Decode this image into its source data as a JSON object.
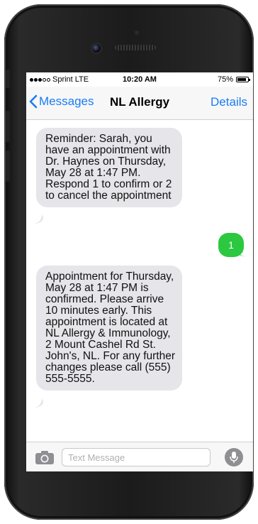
{
  "status_bar": {
    "carrier": "Sprint",
    "network": "LTE",
    "time": "10:20 AM",
    "battery": "75%",
    "signal_bars_filled": 3,
    "signal_bars_total": 5
  },
  "nav": {
    "back_label": "Messages",
    "title": "NL Allergy",
    "details_label": "Details"
  },
  "messages": [
    {
      "direction": "incoming",
      "text": "Reminder: Sarah, you have an appointment with Dr. Haynes on Thursday, May 28 at 1:47 PM. Respond 1 to confirm or 2 to cancel the appointment"
    },
    {
      "direction": "outgoing",
      "text": "1"
    },
    {
      "direction": "incoming",
      "text": "Appointment for Thursday, May 28 at 1:47 PM is confirmed. Please arrive 10 minutes early. This appointment is located at NL Allergy & Immunology, 2 Mount Cashel Rd St. John's, NL. For any further changes please call (555) 555-5555."
    }
  ],
  "composer": {
    "placeholder": "Text Message",
    "camera_icon": "camera-icon",
    "mic_icon": "microphone-icon"
  },
  "colors": {
    "accent": "#1a7cf5",
    "incoming_bubble": "#e5e5ea",
    "outgoing_bubble": "#2bc840"
  }
}
